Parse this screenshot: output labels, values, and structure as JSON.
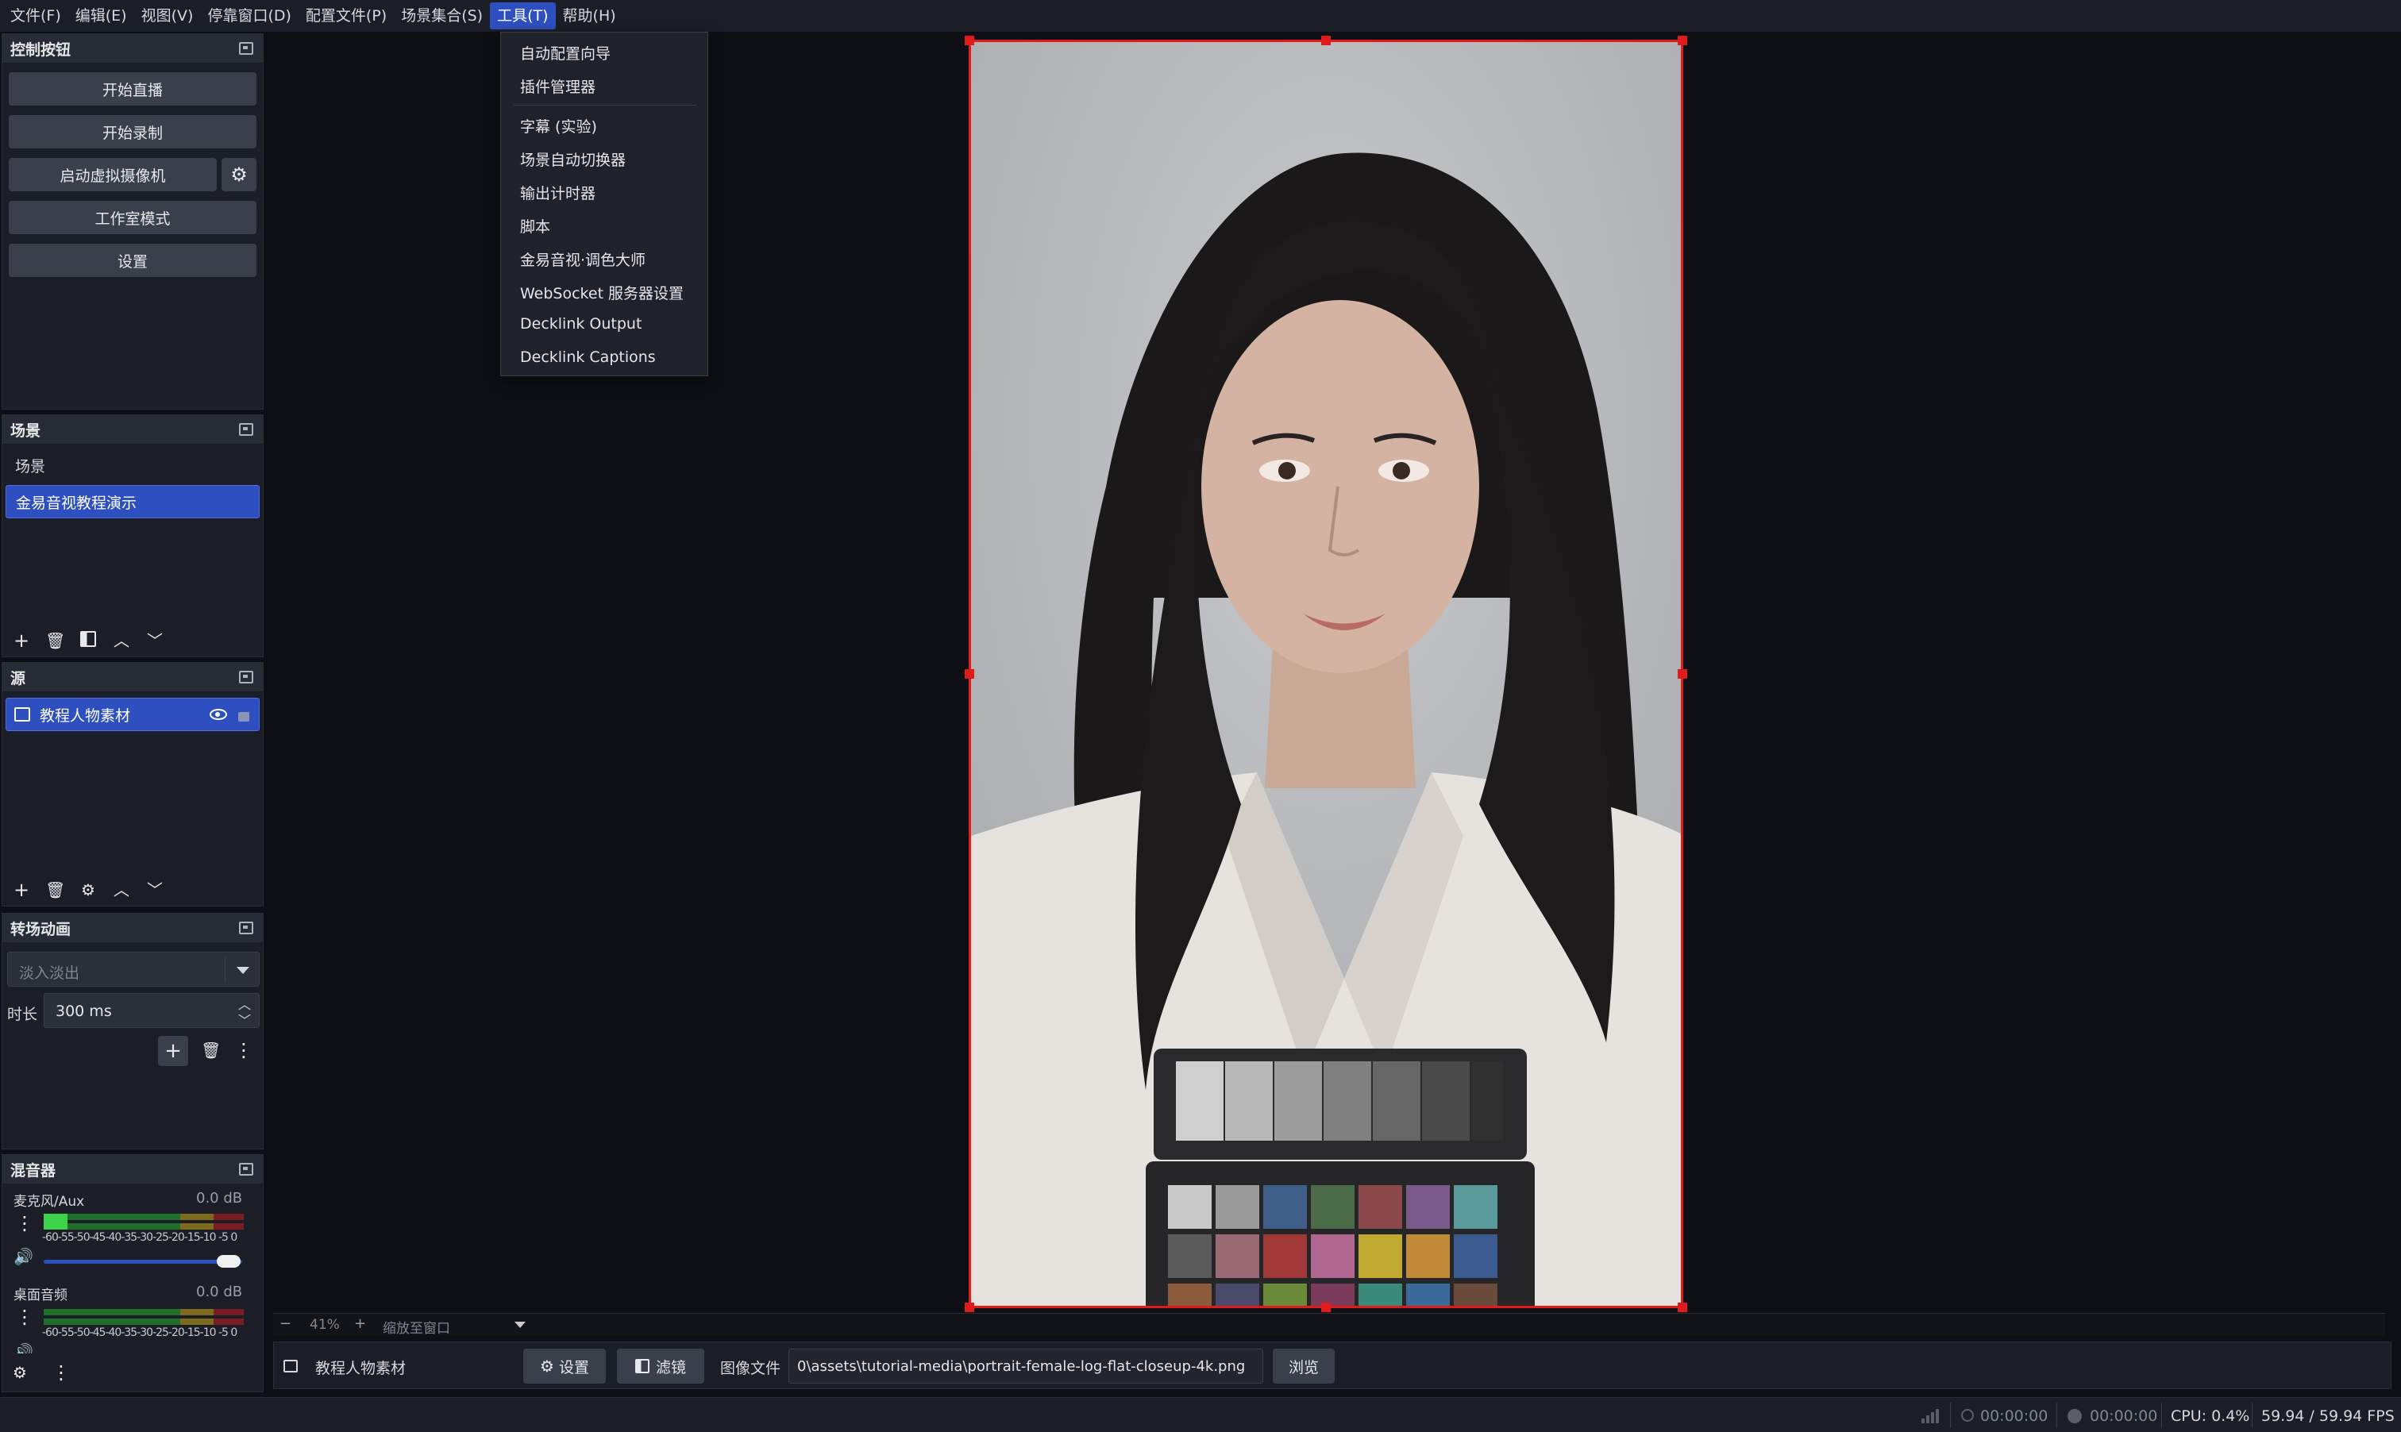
{
  "menubar": {
    "items": [
      "文件(F)",
      "编辑(E)",
      "视图(V)",
      "停靠窗口(D)",
      "配置文件(P)",
      "场景集合(S)",
      "工具(T)",
      "帮助(H)"
    ],
    "active_index": 6
  },
  "tools_menu": {
    "items": [
      "自动配置向导",
      "插件管理器",
      "字幕 (实验)",
      "场景自动切换器",
      "输出计时器",
      "脚本",
      "金易音视·调色大师",
      "WebSocket 服务器设置",
      "Decklink Output",
      "Decklink Captions"
    ]
  },
  "controls": {
    "title": "控制按钮",
    "start_stream": "开始直播",
    "start_record": "开始录制",
    "start_virtual_cam": "启动虚拟摄像机",
    "studio_mode": "工作室模式",
    "settings": "设置"
  },
  "scenes": {
    "title": "场景",
    "items": [
      "场景",
      "金易音视教程演示"
    ],
    "selected_index": 1
  },
  "sources": {
    "title": "源",
    "items": [
      "教程人物素材"
    ]
  },
  "transitions": {
    "title": "转场动画",
    "type_placeholder": "淡入淡出",
    "duration_label": "时长",
    "duration_value": "300 ms"
  },
  "mixer": {
    "title": "混音器",
    "scale": "-60-55-50-45-40-35-30-25-20-15-10 -5  0",
    "channels": [
      {
        "name": "麦克风/Aux",
        "db": "0.0 dB"
      },
      {
        "name": "桌面音频",
        "db": "0.0 dB"
      }
    ]
  },
  "zoom": {
    "minus": "−",
    "level": "41%",
    "plus": "+",
    "fit": "缩放至窗口"
  },
  "props_bar": {
    "source_name": "教程人物素材",
    "settings_label": "设置",
    "filters_label": "滤镜",
    "image_file_label": "图像文件",
    "image_path": "0\\assets\\tutorial-media\\portrait-female-log-flat-closeup-4k.png",
    "browse_label": "浏览"
  },
  "status": {
    "stream_time": "00:00:00",
    "record_time": "00:00:00",
    "cpu": "CPU: 0.4%",
    "fps": "59.94 / 59.94 FPS"
  },
  "icons": {
    "gear": "⚙",
    "add": "+",
    "remove": "🗑",
    "up": "︿",
    "down": "﹀",
    "eye": "👁",
    "lock": "🔒",
    "more": "⋮"
  },
  "colors": {
    "accent": "#2e4fbf",
    "selection_outline": "#e01b1b",
    "panel_bg": "#1b1e26",
    "canvas_bg": "#0d0f14"
  }
}
